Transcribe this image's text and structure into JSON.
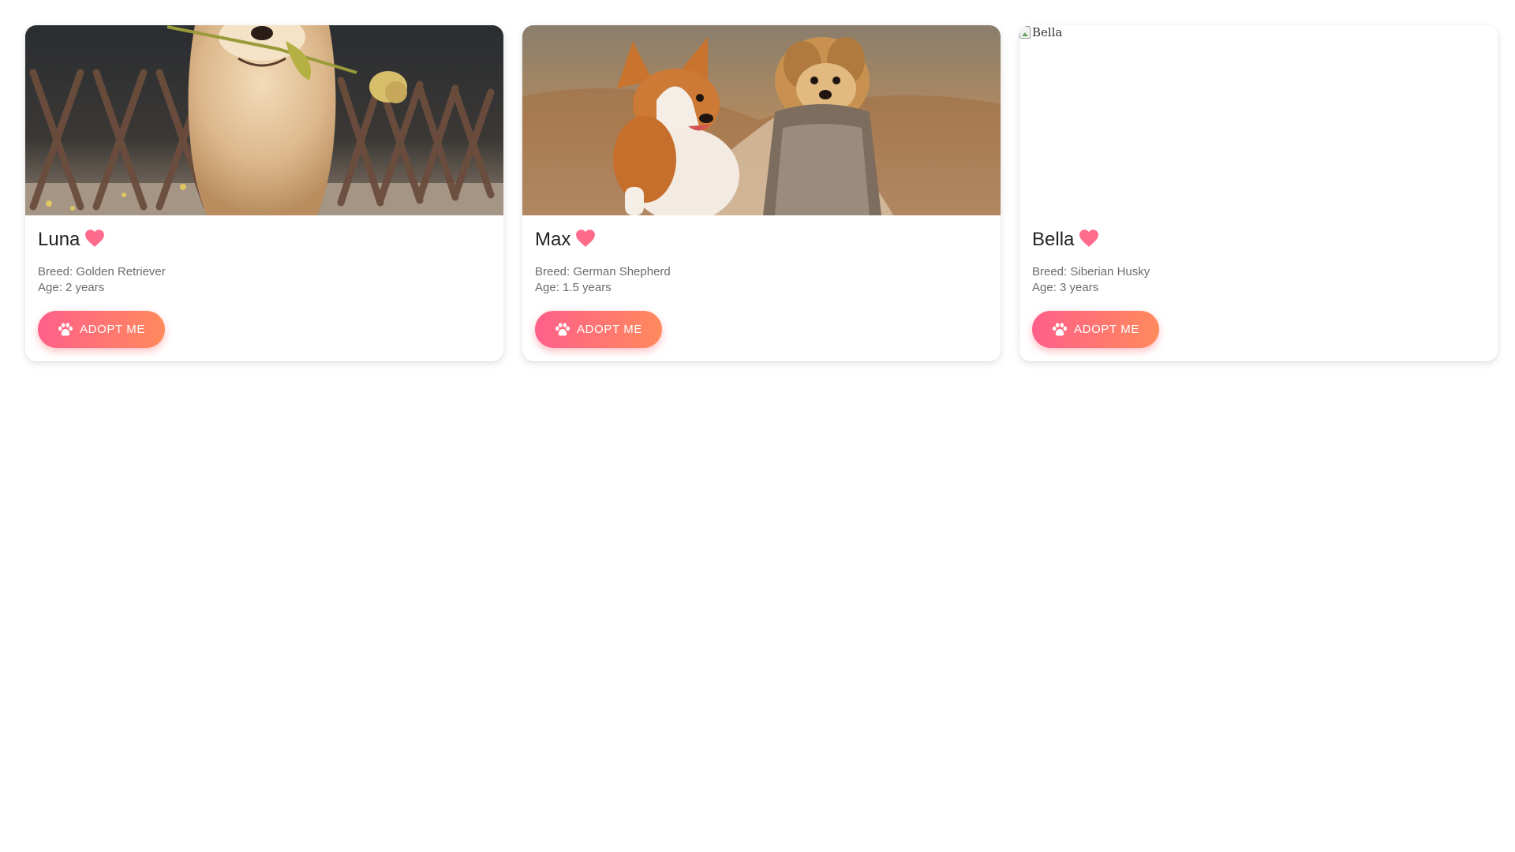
{
  "cards": [
    {
      "name": "Luna",
      "breed": "Breed: Golden Retriever",
      "age": "Age: 2 years",
      "button_label": "ADOPT ME",
      "image": "golden-retriever-photo"
    },
    {
      "name": "Max",
      "breed": "Breed: German Shepherd",
      "age": "Age: 1.5 years",
      "button_label": "ADOPT ME",
      "image": "corgi-and-yorkie-photo"
    },
    {
      "name": "Bella",
      "breed": "Breed: Siberian Husky",
      "age": "Age: 3 years",
      "button_label": "ADOPT ME",
      "image_alt": "Bella"
    }
  ],
  "icons": {
    "favorite": "heart-icon",
    "adopt": "paw-icon"
  },
  "colors": {
    "heart": "#ff6b8b",
    "button_gradient_start": "#ff5f8a",
    "button_gradient_end": "#ff8a5c",
    "name_text": "#222222",
    "meta_text": "#6b6b6b"
  }
}
